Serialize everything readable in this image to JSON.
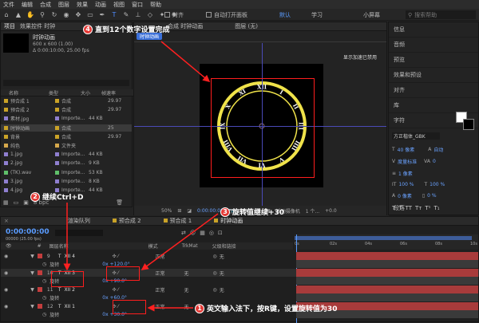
{
  "menu": [
    "文件",
    "编辑",
    "合成",
    "图层",
    "效果",
    "动画",
    "视图",
    "窗口",
    "帮助"
  ],
  "toolbar": {
    "snap_label": "对齐",
    "auto_open": "自动打开面板",
    "ws_default": "默认",
    "ws_learn": "学习",
    "ws_small": "小屏幕",
    "search_placeholder": "搜索帮助"
  },
  "project": {
    "tab": "项目",
    "effects_tab": "效果控件 时钟",
    "comp_name": "时钟动画",
    "comp_info1": "600 x 600 (1.00)",
    "comp_info2": "Δ 0:00:10:00, 25.00 fps",
    "col_name": "名称",
    "col_type": "类型",
    "col_size": "大小",
    "col_fps": "帧速率",
    "items": [
      {
        "name": "预合成 1",
        "type": "合成",
        "size": "",
        "fps": "29.97",
        "color": "#c9a227"
      },
      {
        "name": "预合成 2",
        "type": "合成",
        "size": "",
        "fps": "29.97",
        "color": "#c9a227"
      },
      {
        "name": "素材.jpg",
        "type": "Importe...",
        "size": "44 KB",
        "fps": "",
        "color": "#8f7fd0"
      },
      {
        "name": "时钟动画",
        "type": "合成",
        "size": "",
        "fps": "25",
        "color": "#c9a227"
      },
      {
        "name": "背景",
        "type": "合成",
        "size": "",
        "fps": "29.97",
        "color": "#c9a227"
      },
      {
        "name": "纯色",
        "type": "文件夹",
        "size": "",
        "fps": "",
        "color": "#d5a84c"
      },
      {
        "name": "1.jpg",
        "type": "Importe...",
        "size": "44 KB",
        "fps": "",
        "color": "#8f7fd0"
      },
      {
        "name": "2.jpg",
        "type": "Importe...",
        "size": "9 KB",
        "fps": "",
        "color": "#8f7fd0"
      },
      {
        "name": "(TK).wav",
        "type": "Importe...",
        "size": "53 KB",
        "fps": "",
        "color": "#5fbf6a"
      },
      {
        "name": "3.jpg",
        "type": "Importe...",
        "size": "8 KB",
        "fps": "",
        "color": "#8f7fd0"
      },
      {
        "name": "4.jpg",
        "type": "Importe...",
        "size": "44 KB",
        "fps": "",
        "color": "#8f7fd0"
      }
    ],
    "bpc": "8 bpc"
  },
  "viewer": {
    "tab": "合成 时钟动画",
    "layer_tab": "图层 (无)",
    "comp_btn": "时钟动画",
    "notice": "显示加速已禁用",
    "zoom": "50%",
    "time": "0:00:00:00",
    "quality": "完整",
    "camera": "活动摄像机",
    "views": "1 个...",
    "offset": "+0.0"
  },
  "roman": [
    "XII",
    "I",
    "II",
    "III",
    "IIII",
    "V",
    "VI",
    "VII",
    "VIII",
    "IX",
    "X",
    "XI"
  ],
  "sidebar": [
    "信息",
    "音频",
    "预览",
    "效果和预设",
    "对齐",
    "库",
    "字符",
    "段落"
  ],
  "character": {
    "font": "方正楷体_GBK",
    "style": "",
    "size": "40 像素",
    "leading": "自动",
    "tracking": "0",
    "kerning": "度量标准",
    "stroke": "1 像素",
    "vscale": "100 %",
    "hscale": "100 %",
    "baseline": "0 像素",
    "tsume": "0 %"
  },
  "timeline": {
    "tabs": [
      "渲染队列",
      "预合成 2",
      "预合成 1",
      "时钟动画"
    ],
    "time": "0:00:00:00",
    "fps_info": "00000 (25.00 fps)",
    "col_name": "图层名称",
    "col_mode": "模式",
    "col_trk": "TrkMat",
    "col_parent": "父级和链接",
    "ruler": [
      "0s",
      "02s",
      "04s",
      "06s",
      "08s",
      "10s"
    ],
    "layers": [
      {
        "num": "9",
        "name": "XII 4",
        "mode": "正常",
        "trk": "",
        "parent": "无",
        "prop": "旋转",
        "val": "0x +120.0°",
        "sel": false
      },
      {
        "num": "10",
        "name": "XII 3",
        "mode": "正常",
        "trk": "无",
        "parent": "无",
        "prop": "旋转",
        "val": "0x +90.0°",
        "sel": true
      },
      {
        "num": "11",
        "name": "XII 2",
        "mode": "正常",
        "trk": "无",
        "parent": "无",
        "prop": "旋转",
        "val": "0x +60.0°",
        "sel": false
      },
      {
        "num": "12",
        "name": "XII 1",
        "mode": "正常",
        "trk": "无",
        "parent": "无",
        "prop": "旋转",
        "val": "0x +30.0°",
        "sel": false
      }
    ]
  },
  "annotations": {
    "a1": "英文输入法下，按R键，设置旋转值为30",
    "a2": "继续Ctrl+D",
    "a3": "旋转值继续+30",
    "a4": "直到12个数字设置完成",
    "n1": "1",
    "n2": "2",
    "n3": "3",
    "n4": "4"
  }
}
